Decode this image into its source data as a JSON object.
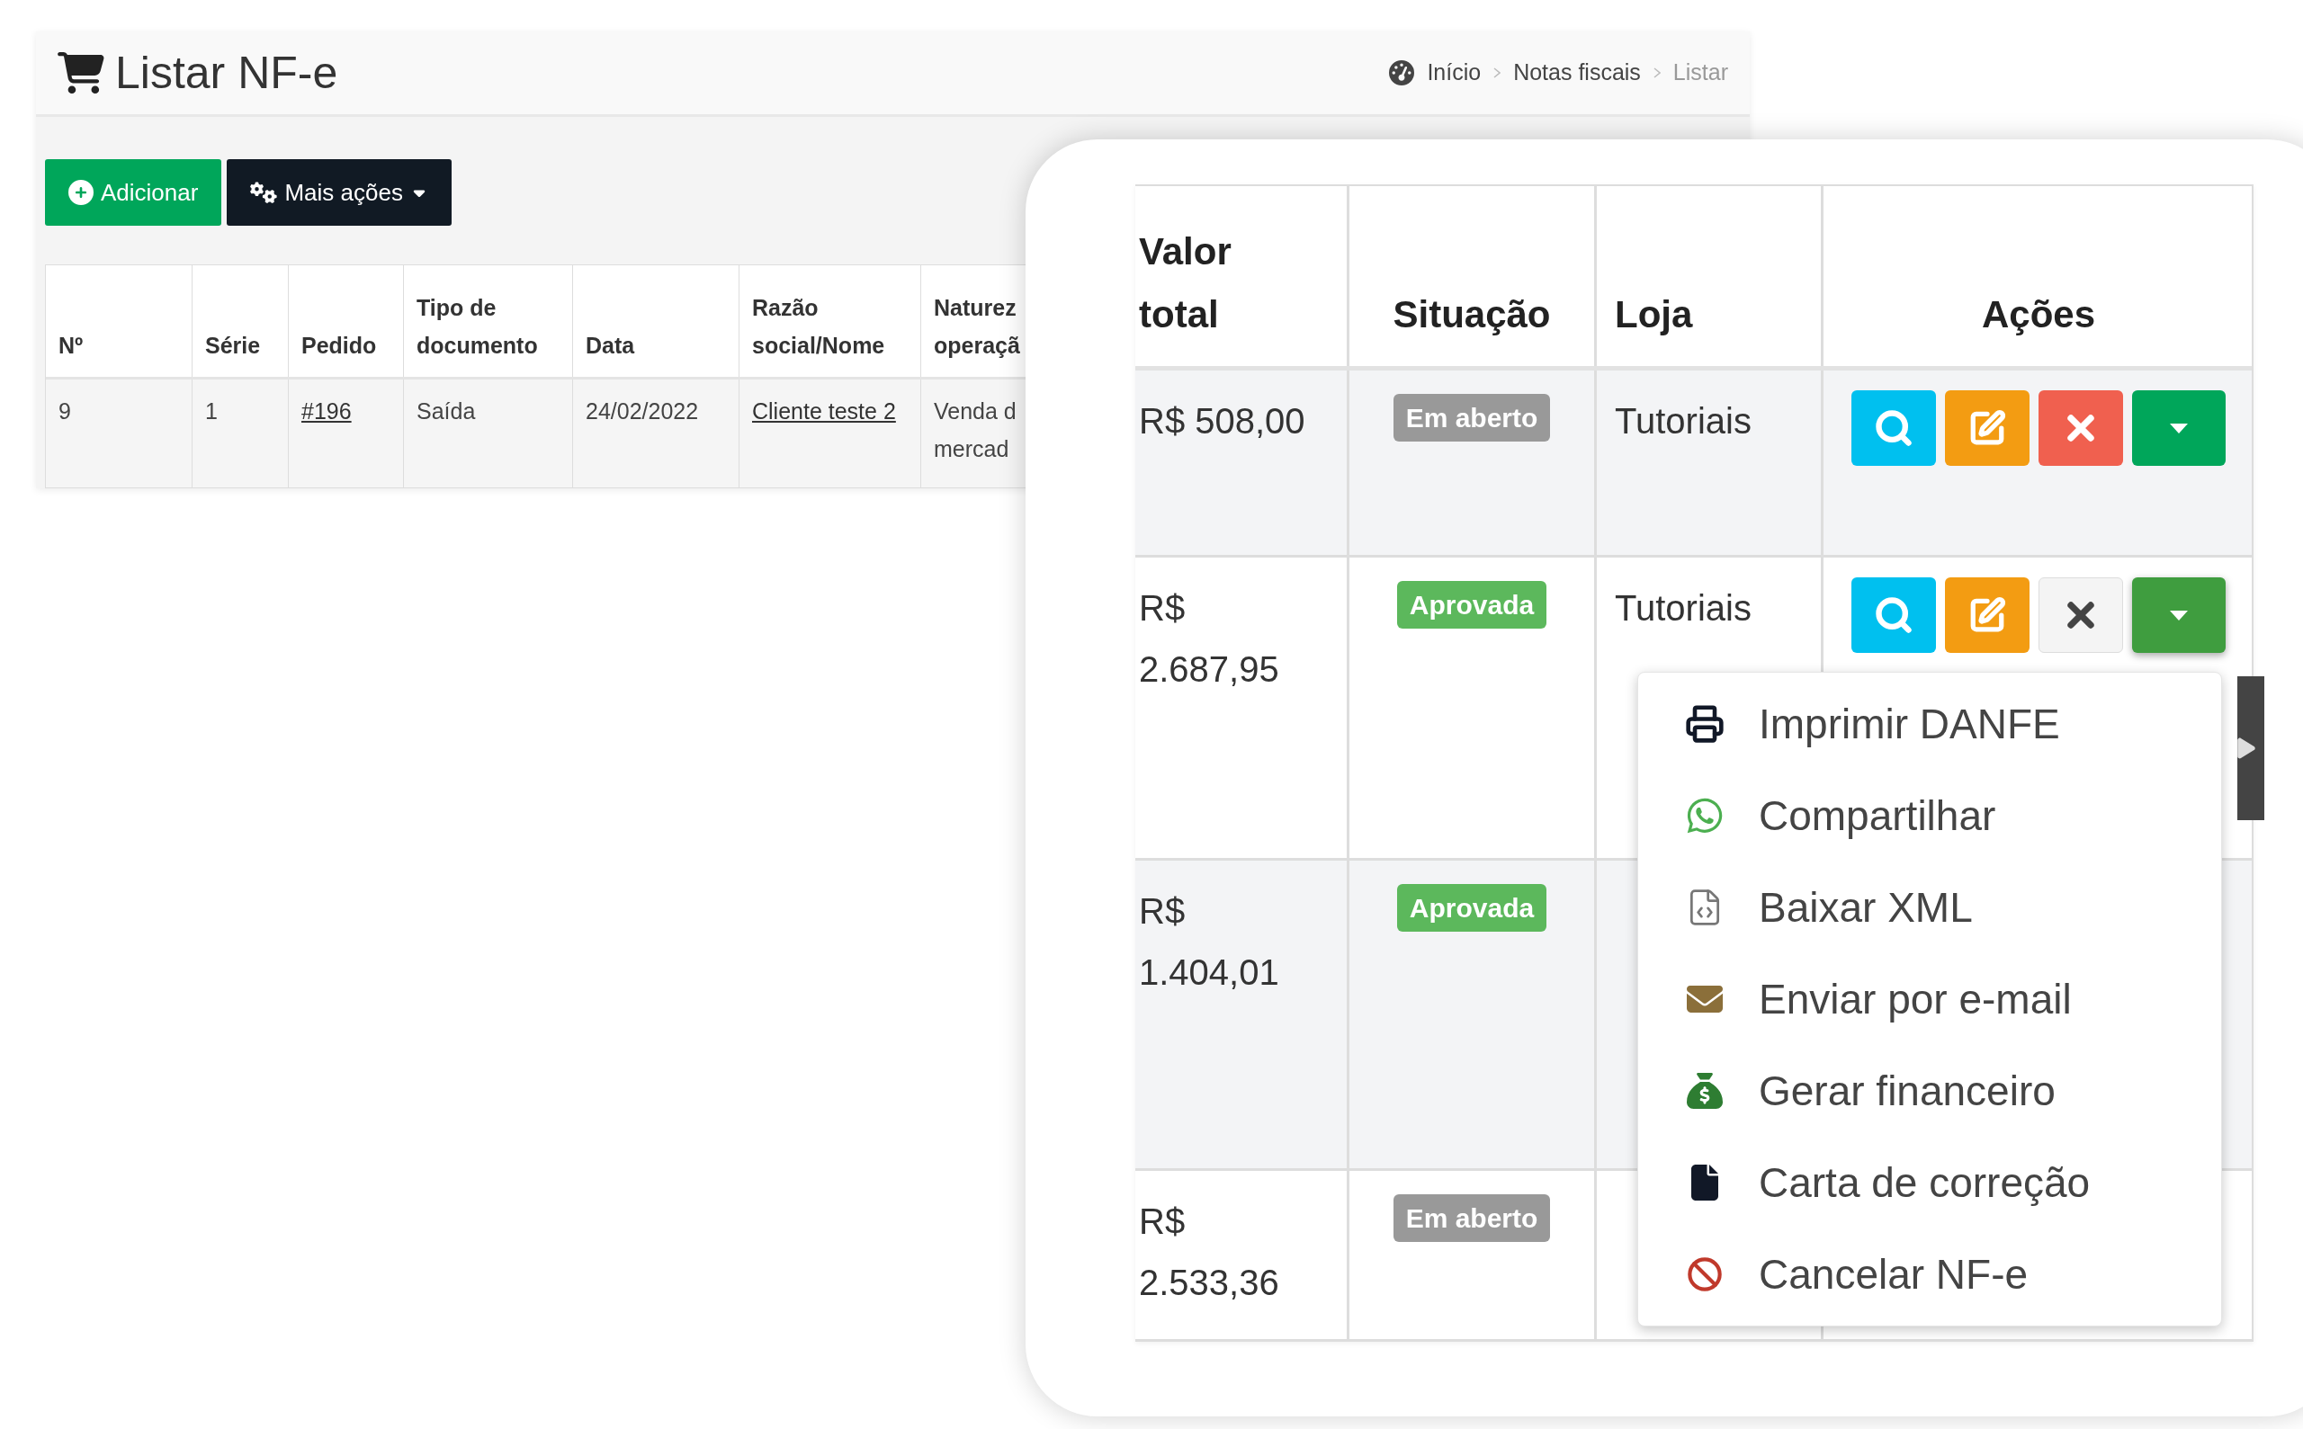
{
  "page": {
    "title": "Listar NF-e",
    "breadcrumb": [
      "Início",
      "Notas fiscais",
      "Listar"
    ],
    "buttons": [
      {
        "kind": "add",
        "label": "Adicionar"
      },
      {
        "kind": "more",
        "label": "Mais ações"
      }
    ],
    "table": {
      "columns": [
        "Nº",
        "Série",
        "Pedido",
        "Tipo de documento",
        "Data",
        "Razão social/Nome",
        "Naturez operaçã"
      ],
      "rows": [
        {
          "cells": [
            "9",
            "1",
            "#196",
            "Saída",
            "24/02/2022",
            "Cliente teste 2",
            "Venda d mercad"
          ],
          "links": [
            false,
            false,
            true,
            false,
            false,
            true,
            false
          ]
        }
      ]
    }
  },
  "detail": {
    "columns": [
      "Valor total",
      "Situação",
      "Loja",
      "Ações"
    ],
    "rows": [
      {
        "value": "R$ 508,00",
        "status": {
          "kind": "open",
          "label": "Em aberto"
        },
        "store": "Tutoriais",
        "actions": true,
        "delete_disabled": false,
        "menu_open": false
      },
      {
        "value": "R$ 2.687,95",
        "status": {
          "kind": "approved",
          "label": "Aprovada"
        },
        "store": "Tutoriais",
        "actions": true,
        "delete_disabled": true,
        "menu_open": true
      },
      {
        "value": "R$ 1.404,01",
        "status": {
          "kind": "approved",
          "label": "Aprovada"
        },
        "actions": false
      },
      {
        "value": "R$ 2.533,36",
        "status": {
          "kind": "open",
          "label": "Em aberto"
        },
        "actions": false
      }
    ],
    "menu": [
      {
        "kind": "print",
        "label": "Imprimir DANFE"
      },
      {
        "kind": "share",
        "label": "Compartilhar"
      },
      {
        "kind": "xml",
        "label": "Baixar XML"
      },
      {
        "kind": "email",
        "label": "Enviar por e-mail"
      },
      {
        "kind": "finance",
        "label": "Gerar financeiro"
      },
      {
        "kind": "letter",
        "label": "Carta de correção"
      },
      {
        "kind": "cancel",
        "label": "Cancelar NF-e"
      }
    ]
  }
}
